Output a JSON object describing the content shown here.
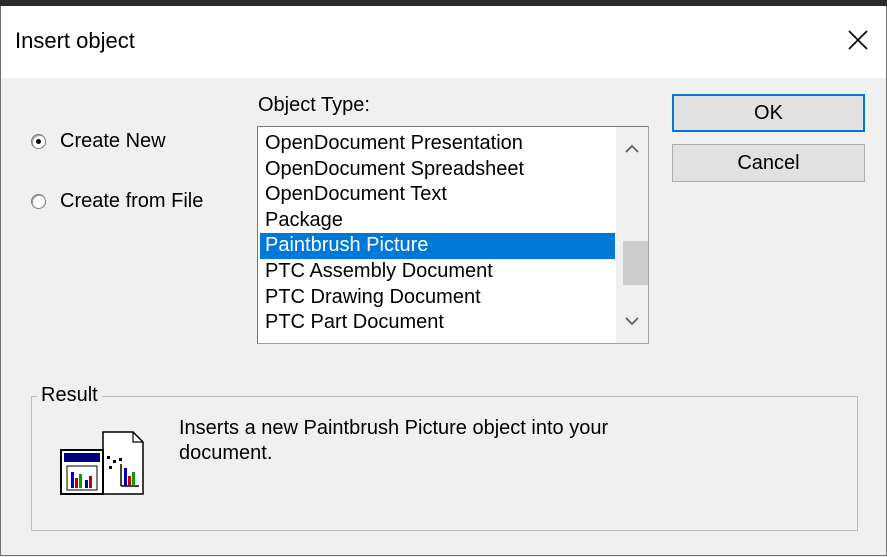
{
  "dialog": {
    "title": "Insert object",
    "close_icon": "close-icon"
  },
  "options": {
    "create_new": "Create New",
    "create_from_file": "Create from File",
    "selected": "create_new"
  },
  "object_type": {
    "label": "Object Type:",
    "items": [
      "OpenDocument Presentation",
      "OpenDocument Spreadsheet",
      "OpenDocument Text",
      "Package",
      "Paintbrush Picture",
      "PTC Assembly Document",
      "PTC Drawing Document",
      "PTC Part Document"
    ],
    "selected_index": 4
  },
  "buttons": {
    "ok": "OK",
    "cancel": "Cancel"
  },
  "result": {
    "legend": "Result",
    "text": "Inserts a new Paintbrush Picture object into your document.",
    "icon": "object-insert-icon"
  },
  "colors": {
    "selection": "#0078d7",
    "dialog_bg": "#f0f0f0"
  }
}
